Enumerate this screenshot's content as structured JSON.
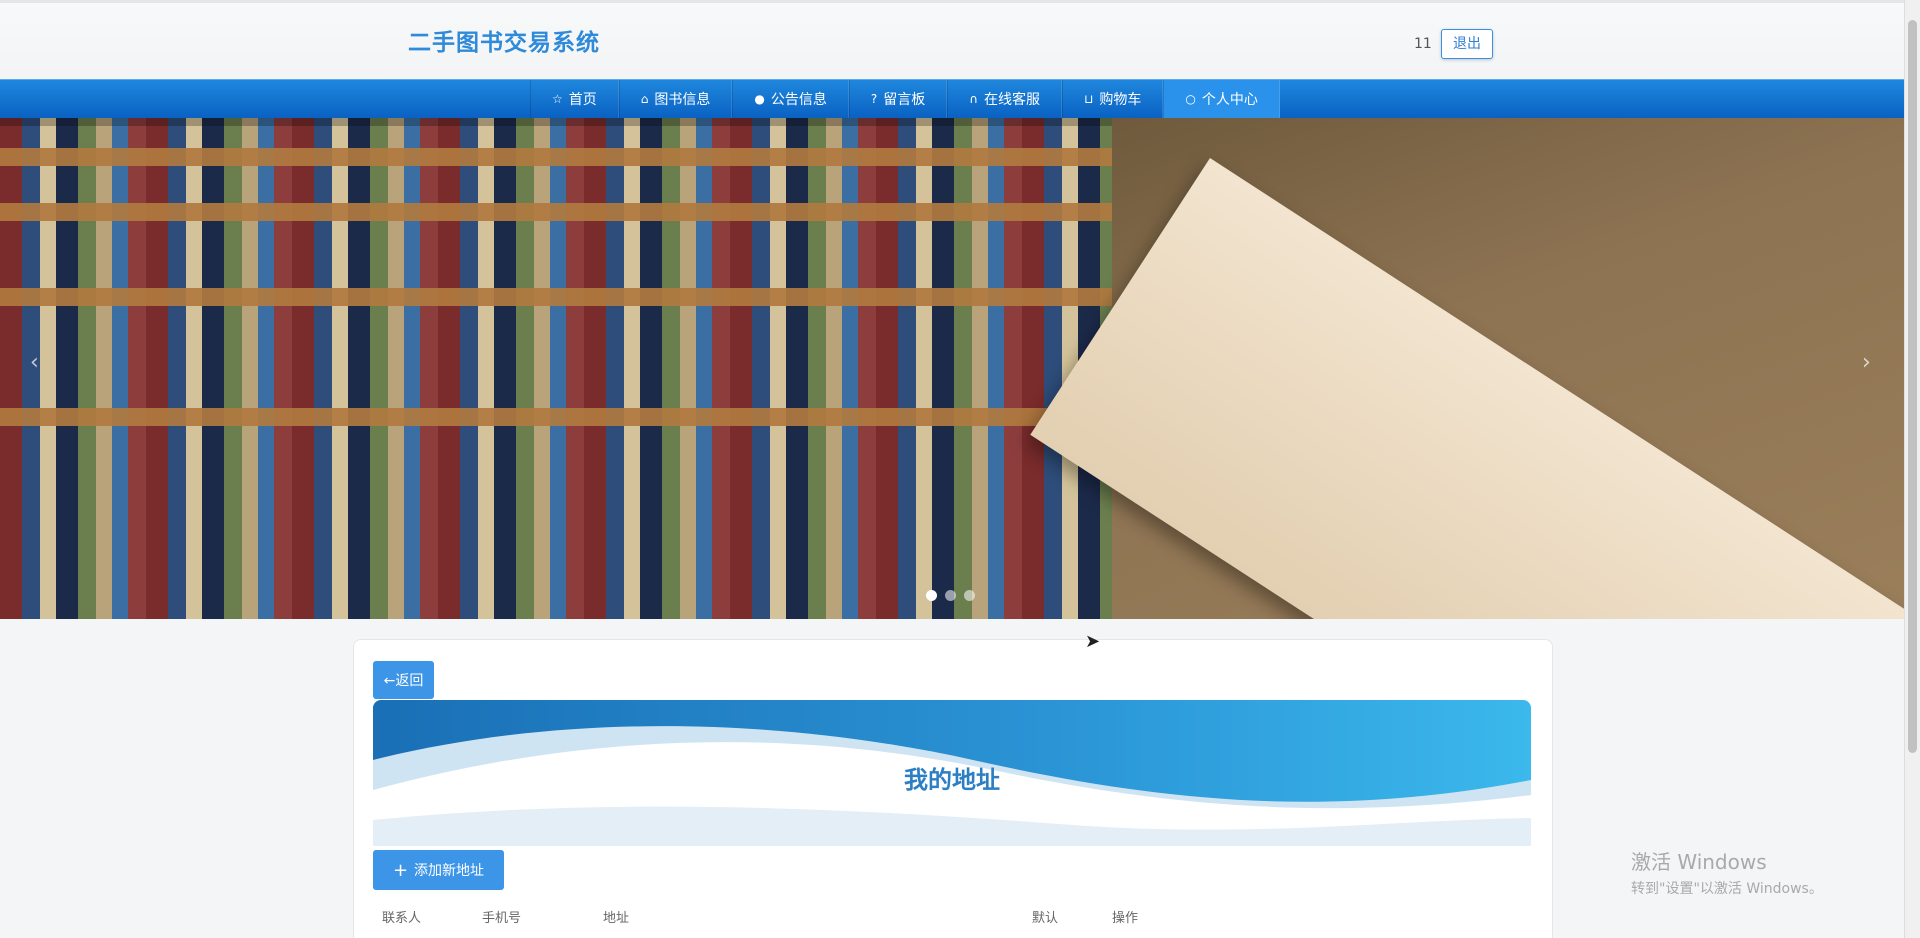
{
  "header": {
    "site_title": "二手图书交易系统",
    "username": "11",
    "logout_label": "退出"
  },
  "nav": {
    "items": [
      {
        "label": "首页",
        "icon": "star-icon"
      },
      {
        "label": "图书信息",
        "icon": "bag-icon"
      },
      {
        "label": "公告信息",
        "icon": "alert-icon"
      },
      {
        "label": "留言板",
        "icon": "question-icon"
      },
      {
        "label": "在线客服",
        "icon": "headset-icon"
      },
      {
        "label": "购物车",
        "icon": "cart-icon"
      },
      {
        "label": "个人中心",
        "icon": "user-icon",
        "active": true
      }
    ]
  },
  "carousel": {
    "slide_count": 3,
    "active_index": 0
  },
  "main": {
    "back_label": "←返回",
    "title": "我的地址",
    "add_label": "添加新地址",
    "table_columns": [
      "联系人",
      "手机号",
      "地址",
      "默认",
      "操作"
    ]
  },
  "watermark": {
    "line1": "激活 Windows",
    "line2": "转到\"设置\"以激活 Windows。"
  },
  "colors": {
    "accent": "#3d95e8",
    "nav_bg": "#0a62c3",
    "title": "#2c7fc5"
  }
}
